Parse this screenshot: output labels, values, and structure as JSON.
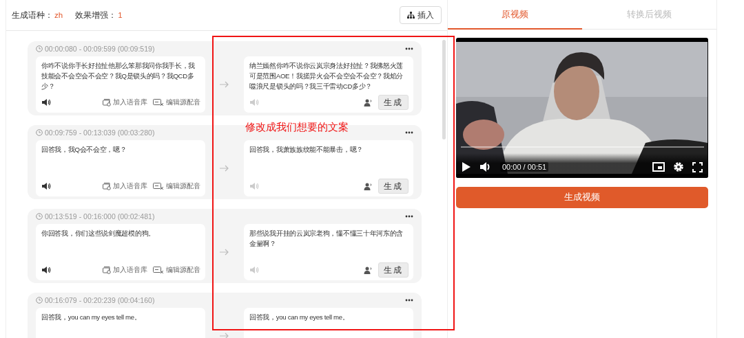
{
  "header": {
    "language_label": "生成语种：",
    "language_value": "zh",
    "enhance_label": "效果增强：",
    "enhance_value": "1",
    "insert_button": "插入"
  },
  "segments": [
    {
      "time": "00:00:080 - 00:09:599 (00:09:519)",
      "source_text": "你咋不说你手长好拉扯他那么笨那我问你我手长，我技能会不会空会不会空？我Q是锁头的吗？我QCD多少？",
      "add_library": "加入语音库",
      "edit_dub": "编辑源配音",
      "target_text": "纳兰嫣然你咋不说你云岚宗身法好拉扯？我佛怒火莲可是范围AOE！我搓异火会不会空会不会空？我焰分噬浪尺是锁头的吗？我三千雷动CD多少？",
      "generate": "生成"
    },
    {
      "time": "00:09:759 - 00:13:039 (00:03:280)",
      "source_text": "回答我，我Q会不会空，嗯？",
      "add_library": "加入语音库",
      "edit_dub": "编辑源配音",
      "target_text": "回答我，我萧族族纹能不能暴击，嗯？",
      "generate": "生成"
    },
    {
      "time": "00:13:519 - 00:16:000 (00:02:481)",
      "source_text": "你回答我，你们这些说剑魔超模的狗。",
      "add_library": "加入语音库",
      "edit_dub": "编辑源配音",
      "target_text": "那些说我开挂的云岚宗老狗，懂不懂三十年河东的含金量啊？",
      "generate": "生成"
    },
    {
      "time": "00:16:079 - 00:20:239 (00:04:160)",
      "source_text": "回答我，you can my eyes tell me。",
      "target_text": "回答我，you can my eyes tell me。"
    }
  ],
  "annotation": {
    "text": "修改成我们想要的文案"
  },
  "tabs": [
    {
      "label": "原视频",
      "selected": true
    },
    {
      "label": "转换后视频",
      "selected": false
    }
  ],
  "player": {
    "time": "00:00 / 00:51"
  },
  "generate_video_button": "生成视频"
}
